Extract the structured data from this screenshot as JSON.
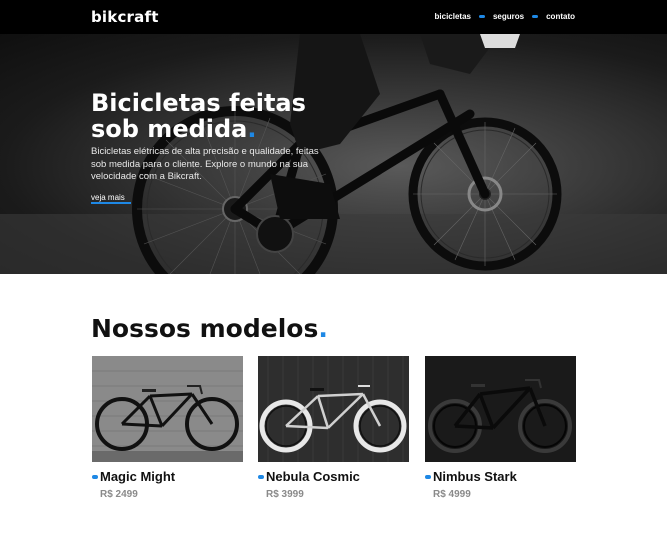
{
  "header": {
    "logo": "bikcraft",
    "nav": [
      {
        "label": "bicicletas"
      },
      {
        "label": "seguros"
      },
      {
        "label": "contato"
      }
    ]
  },
  "hero": {
    "title_line1": "Bicicletas feitas",
    "title_line2": "sob medida",
    "title_accent": ".",
    "text": "Bicicletas elétricas de alta precisão e qualidade, feitas sob medida para o cliente. Explore o mundo na sua velocidade com a Bikcraft.",
    "link": "veja mais"
  },
  "models": {
    "title": "Nossos modelos",
    "title_accent": ".",
    "items": [
      {
        "name": "Magic Might",
        "price": "R$ 2499"
      },
      {
        "name": "Nebula Cosmic",
        "price": "R$ 3999"
      },
      {
        "name": "Nimbus Stark",
        "price": "R$ 4999"
      }
    ]
  },
  "colors": {
    "accent": "#1e88e5",
    "header_bg": "#000000"
  }
}
